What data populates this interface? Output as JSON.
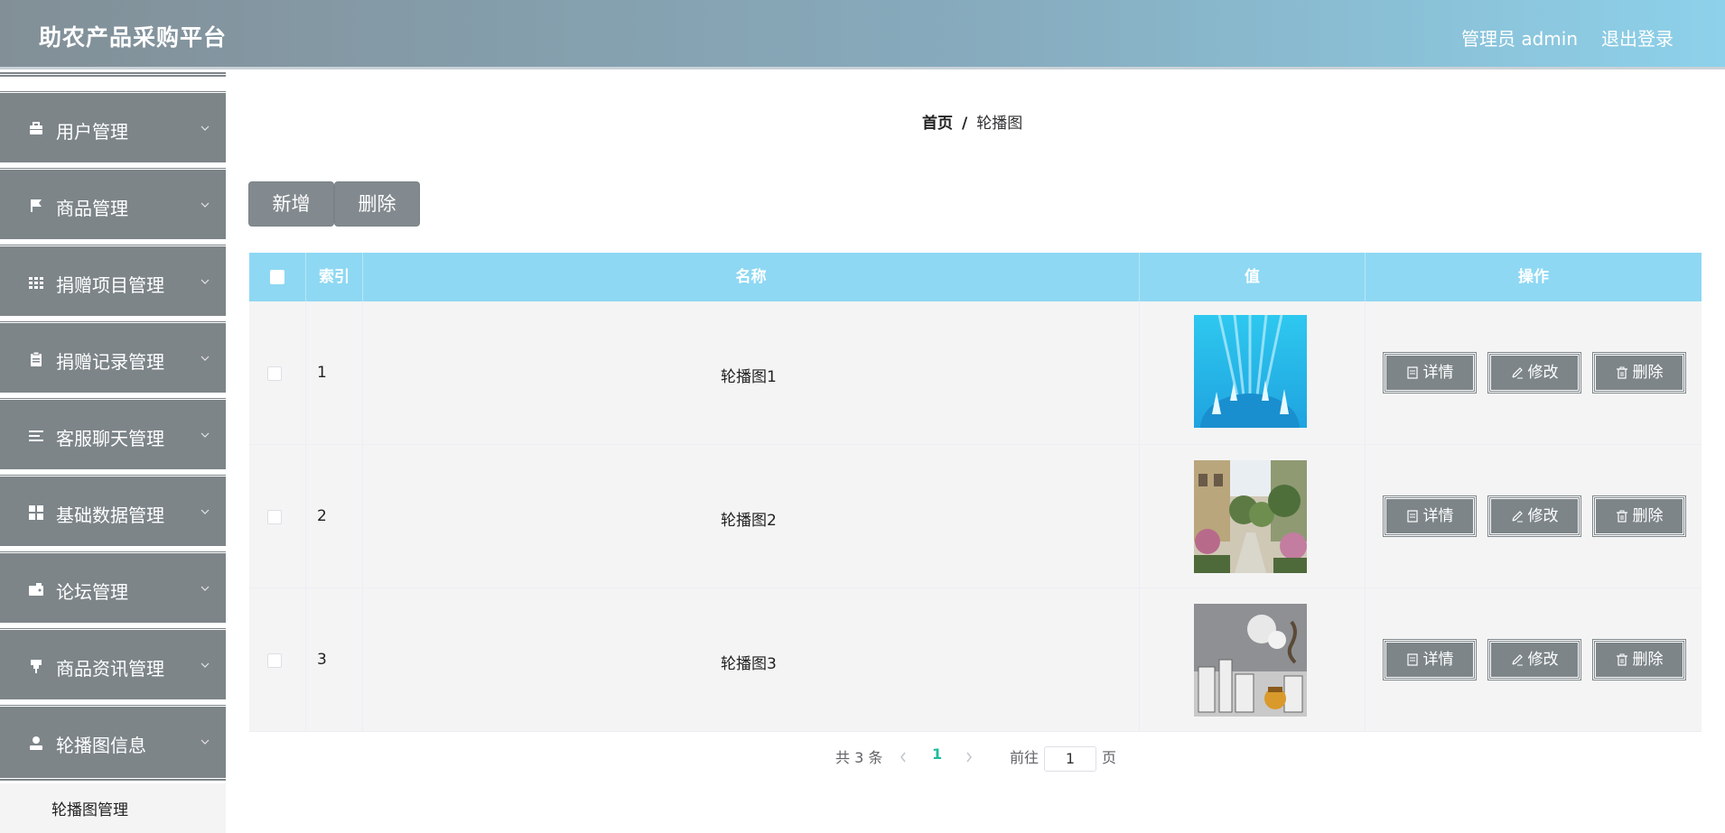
{
  "header": {
    "title": "助农产品采购平台",
    "user": "管理员 admin",
    "logout": "退出登录"
  },
  "sidebar": {
    "items": [
      {
        "label": "用户管理",
        "icon": "briefcase-icon"
      },
      {
        "label": "商品管理",
        "icon": "flag-icon"
      },
      {
        "label": "捐赠项目管理",
        "icon": "grid-icon"
      },
      {
        "label": "捐赠记录管理",
        "icon": "clipboard-icon"
      },
      {
        "label": "客服聊天管理",
        "icon": "list-icon"
      },
      {
        "label": "基础数据管理",
        "icon": "apps-icon"
      },
      {
        "label": "论坛管理",
        "icon": "wallet-icon"
      },
      {
        "label": "商品资讯管理",
        "icon": "pushpin-icon"
      },
      {
        "label": "轮播图信息",
        "icon": "user-icon"
      }
    ],
    "submenu": {
      "label": "轮播图管理"
    }
  },
  "breadcrumb": {
    "home": "首页",
    "separator": "/",
    "current": "轮播图"
  },
  "toolbar": {
    "add_label": "新增",
    "delete_label": "删除"
  },
  "table": {
    "headers": {
      "index": "索引",
      "name": "名称",
      "value": "值",
      "actions": "操作"
    },
    "rows": [
      {
        "index": "1",
        "name": "轮播图1"
      },
      {
        "index": "2",
        "name": "轮播图2"
      },
      {
        "index": "3",
        "name": "轮播图3"
      }
    ],
    "actions": {
      "detail": "详情",
      "edit": "修改",
      "delete": "删除"
    }
  },
  "pagination": {
    "total": "共 3 条",
    "current_page": "1",
    "goto_prefix": "前往",
    "goto_value": "1",
    "goto_suffix": "页"
  },
  "colors": {
    "header_start": "#828f97",
    "header_end": "#8dd1ea",
    "sidebar_item": "#7d8589",
    "table_header": "#8ed8f3",
    "active_page": "#1abc9c"
  }
}
